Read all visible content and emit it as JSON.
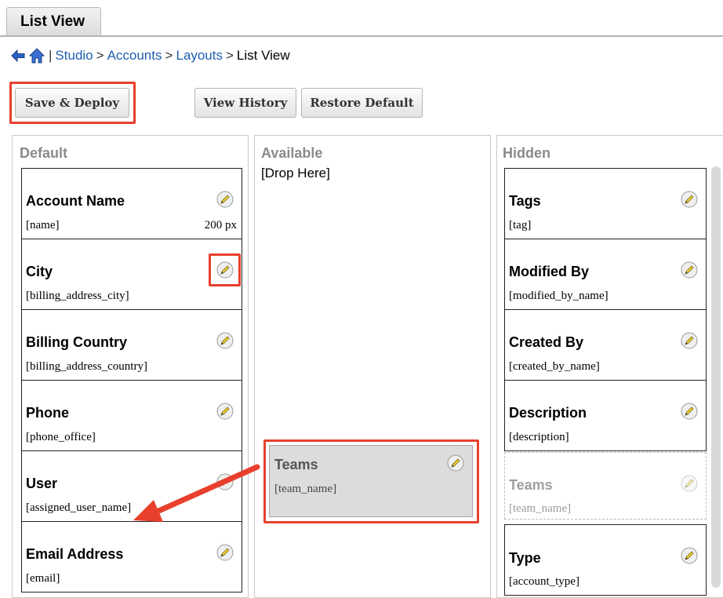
{
  "tab": {
    "label": "List View"
  },
  "breadcrumb": {
    "separator": "|",
    "arrow": ">",
    "studio": "Studio",
    "accounts": "Accounts",
    "layouts": "Layouts",
    "current": "List View"
  },
  "toolbar": {
    "save_deploy": "Save & Deploy",
    "view_history": "View History",
    "restore_default": "Restore Default"
  },
  "columns": {
    "default": {
      "title": "Default",
      "fields": [
        {
          "label": "Account Name",
          "name": "[name]",
          "width": "200 px"
        },
        {
          "label": "City",
          "name": "[billing_address_city]"
        },
        {
          "label": "Billing Country",
          "name": "[billing_address_country]"
        },
        {
          "label": "Phone",
          "name": "[phone_office]"
        },
        {
          "label": "User",
          "name": "[assigned_user_name]"
        },
        {
          "label": "Email Address",
          "name": "[email]"
        }
      ]
    },
    "available": {
      "title": "Available",
      "drop_here": "[Drop Here]",
      "dragging": {
        "label": "Teams",
        "name": "[team_name]"
      }
    },
    "hidden": {
      "title": "Hidden",
      "fields": [
        {
          "label": "Tags",
          "name": "[tag]"
        },
        {
          "label": "Modified By",
          "name": "[modified_by_name]"
        },
        {
          "label": "Created By",
          "name": "[created_by_name]"
        },
        {
          "label": "Description",
          "name": "[description]"
        },
        {
          "label": "Teams",
          "name": "[team_name]"
        },
        {
          "label": "Type",
          "name": "[account_type]"
        }
      ]
    }
  },
  "colors": {
    "highlight": "#e8402d",
    "link": "#1f5fb0",
    "column_title": "#8a8a8a"
  },
  "icons": {
    "back": "back-arrow-icon",
    "home": "home-icon",
    "edit": "pencil-icon"
  }
}
